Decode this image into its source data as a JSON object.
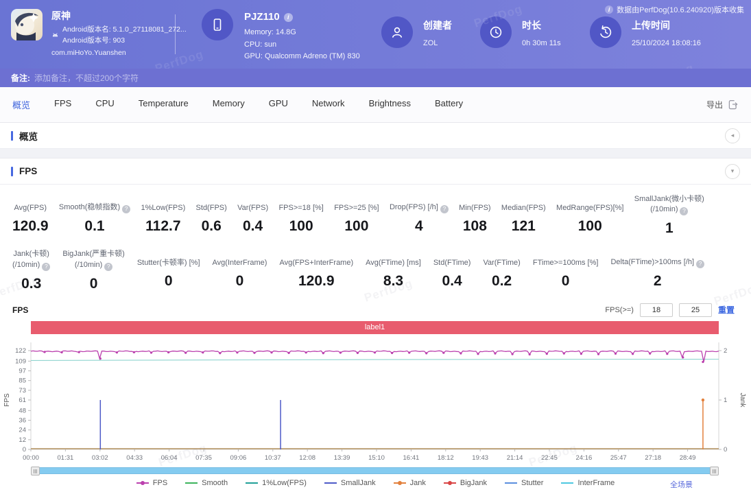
{
  "watermark": "PerfDog",
  "icons": {
    "info": "i",
    "help": "?",
    "collapse_left": "◂",
    "collapse_down": "▾"
  },
  "header": {
    "app": {
      "name": "原神",
      "version_name": "Android版本名: 5.1.0_27118081_272...",
      "version_code": "Android版本号: 903",
      "package": "com.miHoYo.Yuanshen"
    },
    "device": {
      "name": "PJZ110",
      "memory": "Memory: 14.8G",
      "cpu": "CPU: sun",
      "gpu": "GPU: Qualcomm Adreno (TM) 830"
    },
    "creator": {
      "label": "创建者",
      "value": "ZOL"
    },
    "duration": {
      "label": "时长",
      "value": "0h 30m 11s"
    },
    "upload": {
      "label": "上传时间",
      "value": "25/10/2024 18:08:16"
    },
    "collect_note": "数据由PerfDog(10.6.240920)版本收集"
  },
  "note_bar": {
    "label": "备注:",
    "placeholder": "添加备注，不超过200个字符"
  },
  "tabs": [
    {
      "key": "overview",
      "label": "概览",
      "active": true
    },
    {
      "key": "fps",
      "label": "FPS"
    },
    {
      "key": "cpu",
      "label": "CPU"
    },
    {
      "key": "temperature",
      "label": "Temperature"
    },
    {
      "key": "memory",
      "label": "Memory"
    },
    {
      "key": "gpu",
      "label": "GPU"
    },
    {
      "key": "network",
      "label": "Network"
    },
    {
      "key": "brightness",
      "label": "Brightness"
    },
    {
      "key": "battery",
      "label": "Battery"
    }
  ],
  "export_label": "导出",
  "sections": {
    "overview": "概览",
    "fps": "FPS"
  },
  "metrics_row1": [
    {
      "label": "Avg(FPS)",
      "value": "120.9"
    },
    {
      "label": "Smooth(稳帧指数)",
      "help": true,
      "value": "0.1"
    },
    {
      "label": "1%Low(FPS)",
      "value": "112.7"
    },
    {
      "label": "Std(FPS)",
      "value": "0.6"
    },
    {
      "label": "Var(FPS)",
      "value": "0.4"
    },
    {
      "label": "FPS>=18 [%]",
      "value": "100"
    },
    {
      "label": "FPS>=25 [%]",
      "value": "100"
    },
    {
      "label": "Drop(FPS) [/h]",
      "help": true,
      "value": "4"
    },
    {
      "label": "Min(FPS)",
      "value": "108"
    },
    {
      "label": "Median(FPS)",
      "value": "121"
    },
    {
      "label": "MedRange(FPS)[%]",
      "value": "100"
    },
    {
      "label": "SmallJank(微小卡顿)",
      "label2": "(/10min)",
      "help": true,
      "value": "1"
    }
  ],
  "metrics_row2": [
    {
      "label": "Jank(卡顿)",
      "label2": "(/10min)",
      "help": true,
      "value": "0.3"
    },
    {
      "label": "BigJank(严重卡顿)",
      "label2": "(/10min)",
      "help": true,
      "value": "0"
    },
    {
      "label": "Stutter(卡顿率) [%]",
      "value": "0"
    },
    {
      "label": "Avg(InterFrame)",
      "value": "0"
    },
    {
      "label": "Avg(FPS+InterFrame)",
      "value": "120.9"
    },
    {
      "label": "Avg(FTime) [ms]",
      "value": "8.3"
    },
    {
      "label": "Std(FTime)",
      "value": "0.4"
    },
    {
      "label": "Var(FTime)",
      "value": "0.2"
    },
    {
      "label": "FTime>=100ms [%]",
      "value": "0"
    },
    {
      "label": "Delta(FTime)>100ms [/h]",
      "help": true,
      "value": "2"
    }
  ],
  "fps_controls": {
    "label": "FPS(>=)",
    "low": "18",
    "high": "25",
    "reset": "重置"
  },
  "scene_link": "全场景",
  "chart_data": {
    "type": "line",
    "title": "FPS",
    "band_label": "label1",
    "band_color": "#e85c6e",
    "y_left": {
      "label": "FPS",
      "max": 122,
      "ticks": [
        0,
        12,
        24,
        36,
        48,
        61,
        73,
        85,
        97,
        109,
        122
      ]
    },
    "y_right": {
      "label": "Jank",
      "max": 2,
      "ticks": [
        0,
        1,
        2
      ]
    },
    "duration_sec": 1811,
    "tick_interval_sec": 91,
    "x_ticks": [
      "00:00",
      "01:31",
      "03:02",
      "04:33",
      "06:04",
      "07:35",
      "09:06",
      "10:37",
      "12:08",
      "13:39",
      "15:10",
      "16:41",
      "18:12",
      "19:43",
      "21:14",
      "22:45",
      "24:16",
      "25:47",
      "27:18",
      "28:49"
    ],
    "fps_line": {
      "name": "FPS",
      "color": "#bb40ae",
      "baseline": 121.2,
      "dips": [
        [
          0.02,
          120.3
        ],
        [
          0.045,
          119.9
        ],
        [
          0.07,
          120.1
        ],
        [
          0.101,
          112.2
        ],
        [
          0.125,
          119.7
        ],
        [
          0.15,
          120.0
        ],
        [
          0.175,
          119.5
        ],
        [
          0.2,
          119.9
        ],
        [
          0.225,
          119.3
        ],
        [
          0.25,
          119.7
        ],
        [
          0.275,
          118.9
        ],
        [
          0.3,
          119.6
        ],
        [
          0.325,
          119.2
        ],
        [
          0.35,
          119.7
        ],
        [
          0.375,
          119.1
        ],
        [
          0.4,
          119.6
        ],
        [
          0.425,
          118.9
        ],
        [
          0.45,
          119.5
        ],
        [
          0.475,
          119.1
        ],
        [
          0.5,
          119.6
        ],
        [
          0.525,
          119.0
        ],
        [
          0.55,
          119.5
        ],
        [
          0.575,
          118.7
        ],
        [
          0.6,
          119.3
        ],
        [
          0.625,
          118.6
        ],
        [
          0.65,
          117.9
        ],
        [
          0.675,
          118.5
        ],
        [
          0.7,
          117.7
        ],
        [
          0.725,
          117.3
        ],
        [
          0.75,
          118.1
        ],
        [
          0.775,
          118.5
        ],
        [
          0.8,
          118.1
        ],
        [
          0.825,
          117.7
        ],
        [
          0.85,
          118.3
        ],
        [
          0.875,
          117.9
        ],
        [
          0.9,
          118.4
        ],
        [
          0.925,
          118.0
        ],
        [
          0.948,
          113.6
        ],
        [
          0.977,
          108.0
        ]
      ]
    },
    "low_line": {
      "name": "1%Low(FPS)",
      "color": "#8fd4cf",
      "points": [
        [
          0,
          109.8
        ],
        [
          0.25,
          110.4
        ],
        [
          0.5,
          110.9
        ],
        [
          0.75,
          111.2
        ],
        [
          1,
          111.4
        ]
      ]
    },
    "zero_line": {
      "value": 0,
      "color": "#b3905f"
    },
    "spikes": [
      {
        "series": "SmallJank",
        "x": 0.101,
        "v": 1
      },
      {
        "series": "SmallJank",
        "x": 0.363,
        "v": 1
      },
      {
        "series": "Jank",
        "x": 0.977,
        "v": 1,
        "dot": true
      }
    ],
    "legend": [
      {
        "name": "FPS",
        "color": "#bb40ae",
        "dot": true
      },
      {
        "name": "Smooth",
        "color": "#3cb45c"
      },
      {
        "name": "1%Low(FPS)",
        "color": "#20a098"
      },
      {
        "name": "SmallJank",
        "color": "#4d5ac8"
      },
      {
        "name": "Jank",
        "color": "#e2803c",
        "dot": true
      },
      {
        "name": "BigJank",
        "color": "#d94545",
        "dot": true
      },
      {
        "name": "Stutter",
        "color": "#5a8ede"
      },
      {
        "name": "InterFrame",
        "color": "#4cc8e0"
      }
    ]
  }
}
